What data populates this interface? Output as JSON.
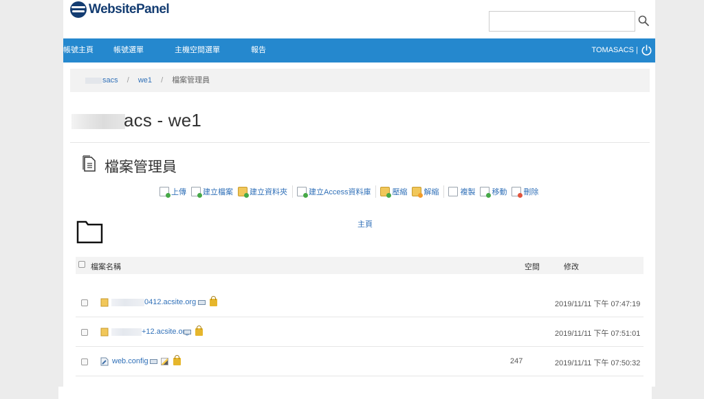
{
  "header": {
    "logo_text": "WebsitePanel",
    "search_placeholder": "",
    "search_icon": "search-icon"
  },
  "navbar": {
    "items": [
      "帳號主頁",
      "帳號選單",
      "主機空間選單",
      "報告"
    ],
    "user": "TOMASACS",
    "separator": "|",
    "power_icon": "power-icon",
    "bg_color": "#2588ce"
  },
  "breadcrumb": {
    "items": [
      "sacs",
      "we1",
      "檔案管理員"
    ],
    "separator": "/"
  },
  "page_title": "acs - we1",
  "file_manager": {
    "heading": "檔案管理員",
    "toolbar": [
      "上傳",
      "建立檔案",
      "建立資料夾",
      "建立Access資料庫",
      "壓縮",
      "解縮",
      "複製",
      "移動",
      "刪除"
    ],
    "home_link": "主頁",
    "columns": {
      "name": "檔案名稱",
      "size": "空間",
      "modified": "修改"
    },
    "rows": [
      {
        "name": "0412.acsite.org",
        "type": "folder",
        "size": "",
        "modified": "2019/11/11 下午 07:47:19"
      },
      {
        "name": "+12.acsite.org",
        "type": "folder",
        "size": "",
        "modified": "2019/11/11 下午 07:51:01"
      },
      {
        "name": "web.config",
        "type": "file",
        "size": "247",
        "modified": "2019/11/11 下午 07:50:32"
      }
    ]
  },
  "colors": {
    "accent": "#2588ce",
    "link": "#3070b8",
    "logo": "#143d72"
  }
}
